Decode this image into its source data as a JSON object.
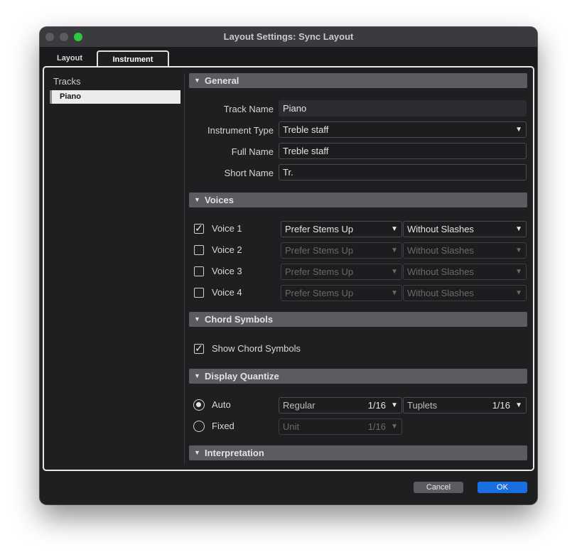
{
  "window": {
    "title": "Layout Settings: Sync Layout"
  },
  "tabs": [
    {
      "label": "Layout"
    },
    {
      "label": "Instrument"
    }
  ],
  "tracks": {
    "title": "Tracks",
    "items": [
      {
        "label": "Piano",
        "selected": true
      }
    ]
  },
  "general": {
    "header": "General",
    "track_name": {
      "label": "Track Name",
      "value": "Piano"
    },
    "instrument_type": {
      "label": "Instrument Type",
      "value": "Treble staff"
    },
    "full_name": {
      "label": "Full Name",
      "value": "Treble staff"
    },
    "short_name": {
      "label": "Short Name",
      "value": "Tr."
    }
  },
  "voices": {
    "header": "Voices",
    "items": [
      {
        "label": "Voice 1",
        "checked": true,
        "stems": "Prefer Stems Up",
        "slashes": "Without Slashes"
      },
      {
        "label": "Voice 2",
        "checked": false,
        "stems": "Prefer Stems Up",
        "slashes": "Without Slashes"
      },
      {
        "label": "Voice 3",
        "checked": false,
        "stems": "Prefer Stems Up",
        "slashes": "Without Slashes"
      },
      {
        "label": "Voice 4",
        "checked": false,
        "stems": "Prefer Stems Up",
        "slashes": "Without Slashes"
      }
    ]
  },
  "chord_symbols": {
    "header": "Chord Symbols",
    "show_label": "Show Chord Symbols",
    "show_checked": true
  },
  "display_quantize": {
    "header": "Display Quantize",
    "auto_label": "Auto",
    "fixed_label": "Fixed",
    "selected": "Auto",
    "regular_label": "Regular",
    "regular_value": "1/16",
    "tuplets_label": "Tuplets",
    "tuplets_value": "1/16",
    "unit_label": "Unit",
    "unit_value": "1/16"
  },
  "interpretation": {
    "header": "Interpretation"
  },
  "buttons": {
    "cancel": "Cancel",
    "ok": "OK"
  },
  "icons": {
    "section_toggle": "triangle-down-icon",
    "dropdown": "dropdown-arrow-icon",
    "check": "check-icon"
  },
  "colors": {
    "accent": "#1a6fe0",
    "zoom": "#2ec840",
    "section_bg": "#5b5c60",
    "window_bg": "#1e1f21"
  }
}
